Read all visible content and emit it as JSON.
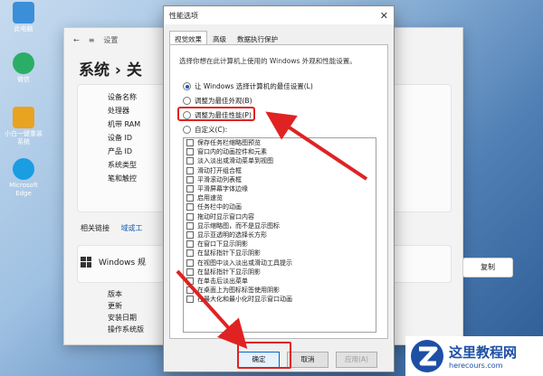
{
  "desktop": {
    "icons": [
      {
        "label": "此电脑",
        "color": "#3a8fd8"
      },
      {
        "label": "微信",
        "color": "#2aae67"
      },
      {
        "label": "小白一键重装系统",
        "color": "#e8a320"
      },
      {
        "label": "Microsoft Edge",
        "color": "#1b9de2"
      }
    ]
  },
  "settings_window": {
    "nav_title": "设置",
    "heading": "系统 › 关",
    "spec_labels": [
      "设备名称",
      "处理器",
      "机带 RAM",
      "设备 ID",
      "产品 ID",
      "系统类型",
      "笔和触控"
    ],
    "related_label": "相关链接",
    "related_link": "域或工",
    "windows_spec_title": "Windows 规",
    "copy_button": "复制",
    "win_spec_labels": [
      "版本",
      "更新",
      "安装日期",
      "操作系统版"
    ],
    "bg_tab": "系统"
  },
  "performance_dialog": {
    "title": "性能选项",
    "close_glyph": "✕",
    "tabs": [
      {
        "label": "视觉效果",
        "active": true
      },
      {
        "label": "高级",
        "active": false
      },
      {
        "label": "数据执行保护",
        "active": false
      }
    ],
    "intro_text": "选择你想在此计算机上使用的 Windows 外观和性能设置。",
    "radio_options": [
      {
        "label": "让 Windows 选择计算机的最佳设置(L)",
        "checked": true
      },
      {
        "label": "调整为最佳外观(B)",
        "checked": false
      },
      {
        "label": "调整为最佳性能(P)",
        "checked": false
      },
      {
        "label": "自定义(C):",
        "checked": false
      }
    ],
    "visual_effects": [
      "保存任务栏缩略图预览",
      "窗口内的动画控件和元素",
      "淡入淡出或滑动菜单到视图",
      "滑动打开组合框",
      "平滑滚动列表框",
      "平滑屏幕字体边缘",
      "启用速览",
      "任务栏中的动画",
      "拖动时显示窗口内容",
      "显示缩略图，而不是显示图标",
      "显示亚透明的选择长方形",
      "在窗口下显示阴影",
      "在鼠标指针下显示阴影",
      "在视图中淡入淡出或滑动工具提示",
      "在鼠标指针下显示阴影",
      "在单击后淡出菜单",
      "在桌面上为图标标签使用阴影",
      "在最大化和最小化时显示窗口动画"
    ],
    "buttons": {
      "ok": "确定",
      "cancel": "取消",
      "apply": "应用(A)"
    }
  },
  "watermark": {
    "cn": "这里教程网",
    "en": "herecours.com"
  },
  "colors": {
    "annotation_red": "#e02222",
    "accent": "#1e56b8"
  }
}
